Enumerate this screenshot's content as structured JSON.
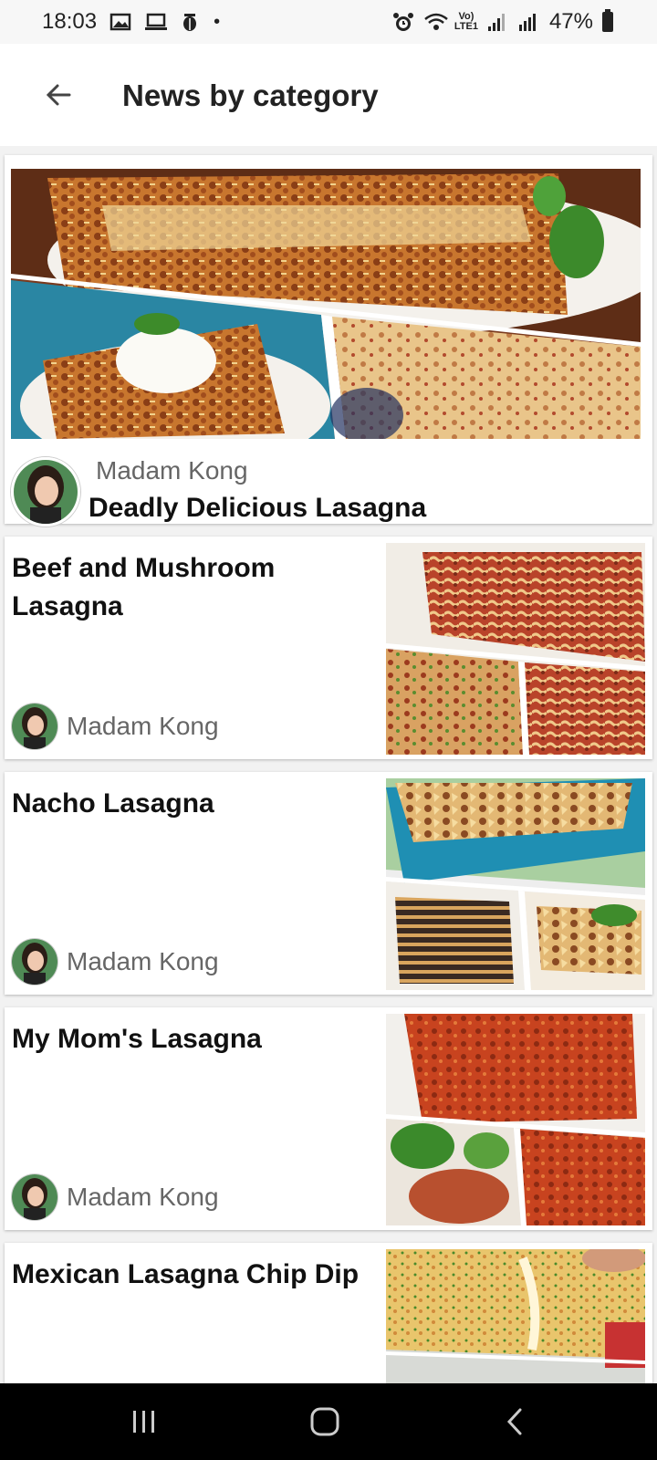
{
  "status_bar": {
    "time": "18:03",
    "battery": "47%",
    "icons_left": [
      "image-icon",
      "laptop-icon",
      "bug-icon",
      "dot-icon"
    ],
    "icons_right": [
      "alarm-icon",
      "wifi-icon",
      "volte-icon",
      "signal-icon",
      "signal-r-icon",
      "battery-icon"
    ]
  },
  "app_bar": {
    "title": "News by category"
  },
  "hero": {
    "author": "Madam Kong",
    "title": "Deadly Delicious Lasagna"
  },
  "articles": [
    {
      "title": "Beef and Mushroom Lasagna",
      "author": "Madam Kong"
    },
    {
      "title": "Nacho Lasagna",
      "author": "Madam Kong"
    },
    {
      "title": "My Mom's Lasagna",
      "author": "Madam Kong"
    },
    {
      "title": "Mexican Lasagna Chip Dip",
      "author": ""
    }
  ],
  "colors": {
    "accent": "#111111",
    "muted_text": "#666666",
    "background": "#f2f2f2",
    "nav_bar": "#000000"
  }
}
